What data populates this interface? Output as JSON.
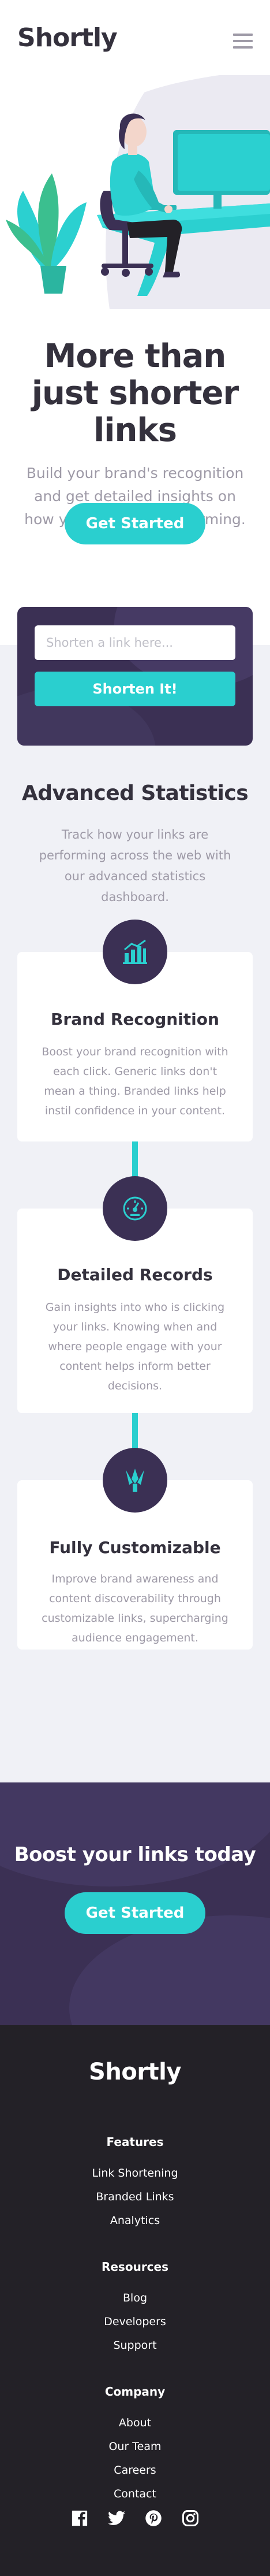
{
  "header": {
    "logo": "Shortly",
    "menu_icon": "hamburger-menu-icon"
  },
  "hero": {
    "title": "More than just shorter links",
    "subtitle": "Build your brand's recognition and get detailed insights on how your links are performing.",
    "cta_label": "Get Started",
    "illustration": "person-working-at-desk-illustration"
  },
  "shorten": {
    "placeholder": "Shorten a link here...",
    "button_label": "Shorten It!"
  },
  "statistics": {
    "title": "Advanced Statistics",
    "subtitle": "Track how your links are performing across the web with our advanced statistics dashboard.",
    "cards": [
      {
        "icon": "bar-chart-icon",
        "title": "Brand Recognition",
        "description": "Boost your brand recognition with each click. Generic links don't mean a thing. Branded links help instil confidence in your content."
      },
      {
        "icon": "gauge-icon",
        "title": "Detailed Records",
        "description": "Gain insights into who is clicking your links. Knowing when and where people engage with your content helps inform better decisions."
      },
      {
        "icon": "pen-tools-icon",
        "title": "Fully Customizable",
        "description": "Improve brand awareness and content discoverability through customizable links, supercharging audience engagement."
      }
    ]
  },
  "boost": {
    "title": "Boost your links today",
    "cta_label": "Get Started"
  },
  "footer": {
    "logo": "Shortly",
    "groups": [
      {
        "heading": "Features",
        "links": [
          "Link Shortening",
          "Branded Links",
          "Analytics"
        ]
      },
      {
        "heading": "Resources",
        "links": [
          "Blog",
          "Developers",
          "Support"
        ]
      },
      {
        "heading": "Company",
        "links": [
          "About",
          "Our Team",
          "Careers",
          "Contact"
        ]
      }
    ],
    "socials": [
      "facebook-icon",
      "twitter-icon",
      "pinterest-icon",
      "instagram-icon"
    ]
  },
  "colors": {
    "primary_cyan": "#2acfcf",
    "dark_violet": "#3b3054",
    "very_dark_violet": "#232127",
    "grayish_violet": "#9e9aa7",
    "very_dark_blue": "#34313d",
    "light_gray": "#f0f1f6"
  }
}
